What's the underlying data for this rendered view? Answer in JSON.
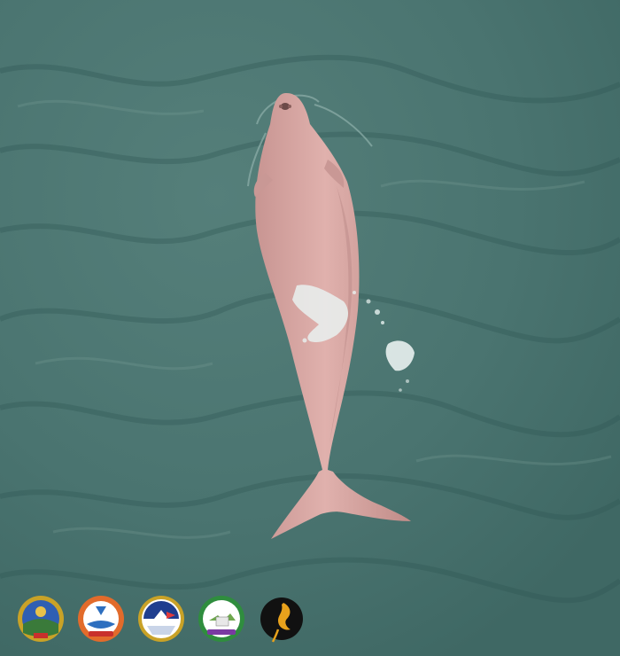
{
  "image": {
    "subject": "dolphin",
    "colors": {
      "water": "#4a7470",
      "water_dark": "#3b625f",
      "water_light": "#6a8f8a",
      "animal": "#d9a6a3",
      "animal_shadow": "#b78682",
      "foam": "#e9f1f0"
    }
  },
  "logos": [
    {
      "name": "emblem-1",
      "colors": [
        "#3a7a3a",
        "#2f5fb3",
        "#c9a227"
      ]
    },
    {
      "name": "emblem-2",
      "colors": [
        "#e26b2b",
        "#2e6fbf",
        "#ffffff"
      ]
    },
    {
      "name": "emblem-3",
      "colors": [
        "#1f3e8f",
        "#e23b3b",
        "#ffffff"
      ]
    },
    {
      "name": "emblem-4",
      "colors": [
        "#2f8d3e",
        "#7a3aa2",
        "#ffffff"
      ]
    },
    {
      "name": "emblem-5",
      "colors": [
        "#111111",
        "#e8a21c"
      ]
    }
  ]
}
